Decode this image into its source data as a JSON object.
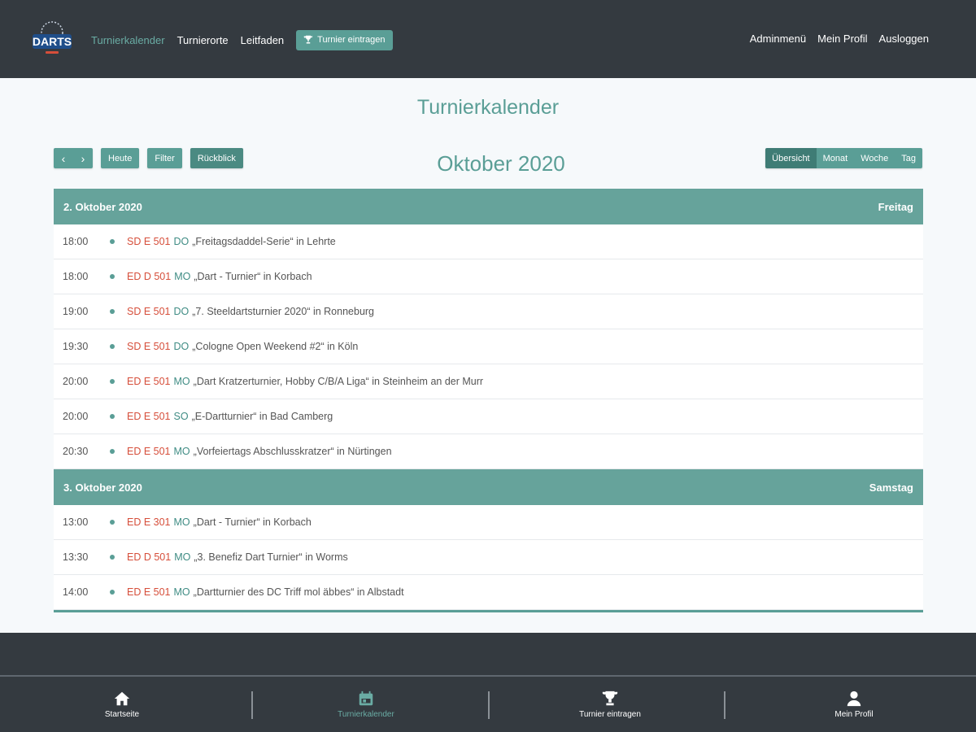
{
  "header": {
    "logo_text": "DARTS",
    "nav": [
      {
        "label": "Turnierkalender",
        "active": true
      },
      {
        "label": "Turnierorte",
        "active": false
      },
      {
        "label": "Leitfaden",
        "active": false
      }
    ],
    "enter_button": "Turnier eintragen",
    "right_nav": [
      "Adminmenü",
      "Mein Profil",
      "Ausloggen"
    ]
  },
  "page": {
    "title": "Turnierkalender",
    "month": "Oktober 2020"
  },
  "toolbar": {
    "prev": "‹",
    "next": "›",
    "today": "Heute",
    "filter": "Filter",
    "review": "Rückblick"
  },
  "views": [
    "Übersicht",
    "Monat",
    "Woche",
    "Tag"
  ],
  "days": [
    {
      "date": "2. Oktober 2020",
      "weekday": "Freitag",
      "events": [
        {
          "time": "18:00",
          "code_a": "SD E 501",
          "code_b": "DO",
          "title": "„Freitagsdaddel-Serie“ in Lehrte"
        },
        {
          "time": "18:00",
          "code_a": "ED D 501",
          "code_b": "MO",
          "title": "„Dart - Turnier“ in Korbach"
        },
        {
          "time": "19:00",
          "code_a": "SD E 501",
          "code_b": "DO",
          "title": "„7. Steeldartsturnier 2020“ in Ronneburg"
        },
        {
          "time": "19:30",
          "code_a": "SD E 501",
          "code_b": "DO",
          "title": "„Cologne Open Weekend #2“ in Köln"
        },
        {
          "time": "20:00",
          "code_a": "ED E 501",
          "code_b": "MO",
          "title": "„Dart Kratzerturnier, Hobby C/B/A Liga“ in Steinheim an der Murr"
        },
        {
          "time": "20:00",
          "code_a": "ED E 501",
          "code_b": "SO",
          "title": "„E-Dartturnier“ in Bad Camberg"
        },
        {
          "time": "20:30",
          "code_a": "ED E 501",
          "code_b": "MO",
          "title": "„Vorfeiertags Abschlusskratzer“ in Nürtingen"
        }
      ]
    },
    {
      "date": "3. Oktober 2020",
      "weekday": "Samstag",
      "events": [
        {
          "time": "13:00",
          "code_a": "ED E 301",
          "code_b": "MO",
          "title": "„Dart - Turnier“ in Korbach"
        },
        {
          "time": "13:30",
          "code_a": "ED D 501",
          "code_b": "MO",
          "title": "„3. Benefiz Dart Turnier“ in Worms"
        },
        {
          "time": "14:00",
          "code_a": "ED E 501",
          "code_b": "MO",
          "title": "„Dartturnier des DC Triff mol äbbes“ in Albstadt"
        }
      ]
    }
  ],
  "bottom_tabs": [
    {
      "label": "Startseite",
      "icon": "home-icon",
      "active": false
    },
    {
      "label": "Turnierkalender",
      "icon": "calendar-icon",
      "active": true
    },
    {
      "label": "Turnier eintragen",
      "icon": "trophy-icon",
      "active": false
    },
    {
      "label": "Mein Profil",
      "icon": "user-icon",
      "active": false
    }
  ],
  "colors": {
    "accent": "#5a9e96",
    "header_bg": "#343a40",
    "code_red": "#d64e3a"
  }
}
